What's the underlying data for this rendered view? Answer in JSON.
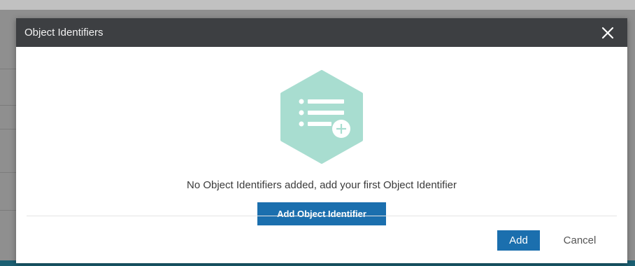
{
  "modal": {
    "title": "Object Identifiers",
    "close_icon": "close-icon",
    "empty_icon": "list-add-icon",
    "empty_message": "No Object Identifiers added, add your first Object Identifier",
    "add_identifier_label": "Add Object Identifier",
    "footer": {
      "add_label": "Add",
      "cancel_label": "Cancel"
    }
  },
  "colors": {
    "header_bg": "#3d3f42",
    "primary_button": "#1b6fae",
    "icon_hex": "#a8ddd0"
  }
}
